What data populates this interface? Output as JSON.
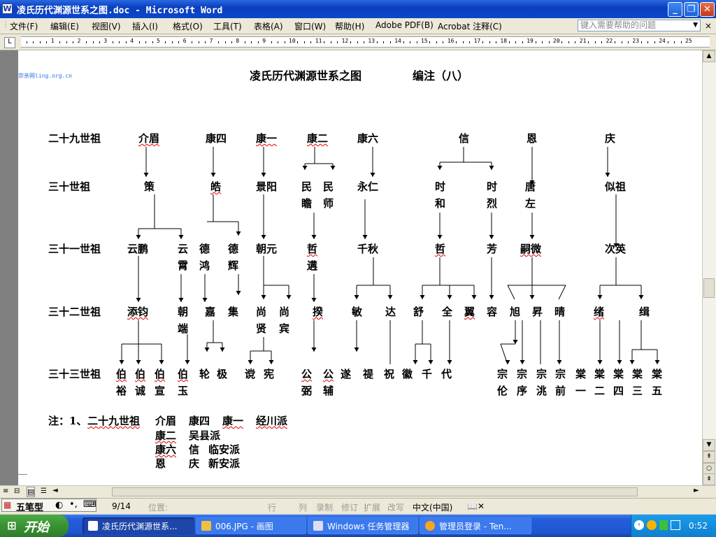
{
  "window": {
    "title": "凌氏历代渊源世系之图.doc - Microsoft Word",
    "app_icon_glyph": "W",
    "buttons": {
      "minimize": "_",
      "maximize": "❐",
      "close": "✕"
    }
  },
  "menu": {
    "items": [
      "文件(F)",
      "编辑(E)",
      "视图(V)",
      "插入(I)",
      "格式(O)",
      "工具(T)",
      "表格(A)",
      "窗口(W)",
      "帮助(H)",
      "Adobe PDF(B)",
      "Acrobat 注释(C)"
    ],
    "help_placeholder": "键入需要帮助的问题",
    "close_glyph": "×"
  },
  "ruler": {
    "numbers": [
      "1",
      "2",
      "3",
      "4",
      "5",
      "6",
      "7",
      "8",
      "9",
      "10",
      "11",
      "12",
      "13",
      "14",
      "15",
      "16",
      "17",
      "18",
      "19",
      "20",
      "21",
      "22",
      "23",
      "24",
      "25"
    ],
    "tab_selector": "L"
  },
  "document": {
    "watermark": "凌氏宗亲网ling.org.cn",
    "title": "凌氏历代渊源世系之图",
    "subtitle": "编注（八）",
    "generations": [
      "二十九世祖",
      "三十世祖",
      "三十一世祖",
      "三十二世祖",
      "三十三世祖"
    ],
    "gen29": [
      "介眉",
      "康四",
      "康一",
      "康二",
      "康六",
      "信",
      "恩",
      "庆"
    ],
    "gen30": [
      "策",
      "皓",
      "景阳",
      "民",
      "民",
      "永仁",
      "时",
      "时",
      "唐",
      "似祖"
    ],
    "gen30_second": [
      "瞻",
      "师",
      "和",
      "烈",
      "左"
    ],
    "gen31": [
      "云鹏",
      "云",
      "德",
      "德",
      "朝元",
      "哲",
      "千秋",
      "哲",
      "芳",
      "嗣微",
      "次英"
    ],
    "gen31_second": [
      "霄",
      "鸿",
      "辉",
      "遘"
    ],
    "gen32": [
      "添钧",
      "朝",
      "嘉",
      "集",
      "尚",
      "尚",
      "揆",
      "敏",
      "达",
      "舒",
      "全",
      "翼",
      "容",
      "旭",
      "昇",
      "晴",
      "绪",
      "缉"
    ],
    "gen32_second": [
      "端",
      "贤",
      "宾"
    ],
    "gen33": [
      "伯",
      "伯",
      "伯",
      "伯",
      "轮",
      "极",
      "谠",
      "宪",
      "公",
      "公",
      "遂",
      "禔",
      "祝",
      "徽",
      "千",
      "代",
      "宗",
      "宗",
      "宗",
      "宗",
      "棠",
      "棠",
      "棠",
      "棠",
      "棠"
    ],
    "gen33_second": [
      "裕",
      "诚",
      "宣",
      "玉",
      "弼",
      "辅",
      "伦",
      "序",
      "洮",
      "前",
      "一",
      "二",
      "四",
      "三",
      "五"
    ],
    "note": {
      "label": "注：1、",
      "line1": [
        "二十九世祖",
        "介眉",
        "康四",
        "康一",
        "经川派"
      ],
      "line2": [
        "康二",
        "吴县派"
      ],
      "line3": [
        "康六",
        "信",
        "临安派"
      ],
      "line4": [
        "恩",
        "庆",
        "新安派"
      ]
    }
  },
  "statusbar": {
    "ime": "五笔型",
    "page": "9/14",
    "position_label": "位置:",
    "line_label": "行",
    "col_label": "列",
    "modes": [
      "录制",
      "修订",
      "扩展",
      "改写"
    ],
    "language": "中文(中国)"
  },
  "taskbar": {
    "start": "开始",
    "tasks": [
      "凌氏历代渊源世系...",
      "006.JPG - 画图",
      "Windows 任务管理器",
      "管理员登录 - Ten..."
    ],
    "clock": "0:52"
  },
  "colors": {
    "titlebar": "#0b47c9",
    "taskbar": "#245edb",
    "start": "#3a9234",
    "spellcheck": "#e00000"
  }
}
